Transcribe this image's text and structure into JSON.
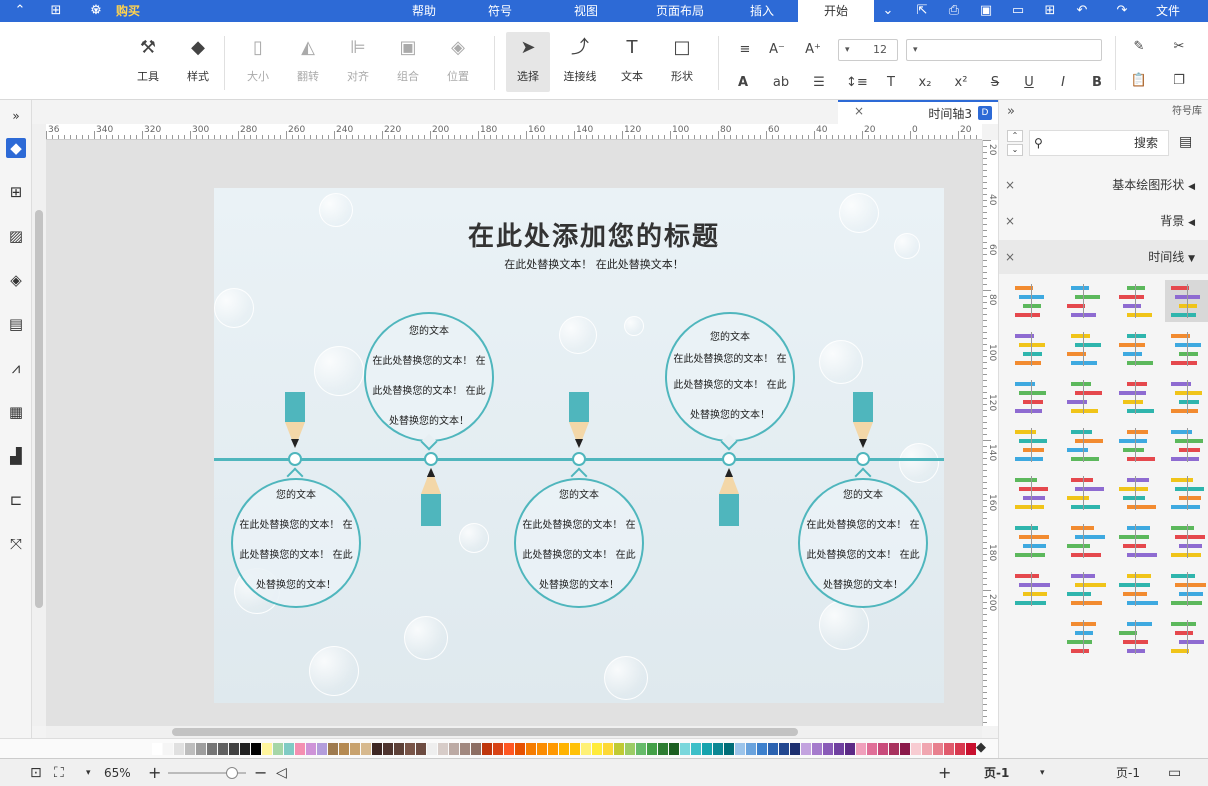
{
  "menubar": {
    "tabs": [
      "文件",
      "开始",
      "插入",
      "页面布局",
      "视图",
      "符号",
      "帮助"
    ],
    "buy_label": "购买"
  },
  "ribbon": {
    "groups_left": [
      {
        "label": "工具",
        "icon": "tool-icon"
      },
      {
        "label": "样式",
        "icon": "paint-bucket-icon"
      },
      {
        "label": "大小",
        "icon": "size-icon"
      },
      {
        "label": "翻转",
        "icon": "flip-icon"
      },
      {
        "label": "对齐",
        "icon": "align-icon"
      },
      {
        "label": "组合",
        "icon": "group-icon"
      },
      {
        "label": "位置",
        "icon": "layers-icon"
      },
      {
        "label": "选择",
        "icon": "select-cursor-icon"
      },
      {
        "label": "连接线",
        "icon": "connector-icon"
      },
      {
        "label": "文本",
        "icon": "text-T-icon"
      },
      {
        "label": "形状",
        "icon": "rectangle-icon"
      }
    ],
    "font_size": "12"
  },
  "library": {
    "header": "符号库",
    "search_placeholder": "搜索",
    "sections": [
      "基本绘图形状",
      "背景",
      "时间线"
    ]
  },
  "document": {
    "tab_title": "时间轴3"
  },
  "sidebar_icons": [
    "fill-icon",
    "grid-icon",
    "image-icon",
    "layers-icon",
    "page-icon",
    "chart-icon",
    "table-icon",
    "org-icon",
    "timeline-icon",
    "shuffle-icon"
  ],
  "ruler": {
    "h_labels": [
      "36",
      "340",
      "320",
      "300",
      "280",
      "260",
      "240",
      "220",
      "200",
      "180",
      "160",
      "140",
      "120",
      "100",
      "80",
      "60",
      "40",
      "20",
      "0",
      "20"
    ],
    "v_labels": [
      "20",
      "40",
      "60",
      "80",
      "100",
      "120",
      "140",
      "160",
      "180",
      "200"
    ]
  },
  "diagram": {
    "title": "在此处添加您的标题",
    "subtitle": "在此处替换文本！ 在此处替换文本！",
    "bubbles_top": [
      {
        "lines": [
          "您的文本",
          "在此处替换您的文本！ 在",
          "此处替换您的文本！ 在此",
          "处替换您的文本！"
        ]
      },
      {
        "lines": [
          "您的文本",
          "在此处替换您的文本！ 在",
          "此处替换您的文本！ 在此",
          "处替换您的文本！"
        ]
      }
    ],
    "bubbles_bottom": [
      {
        "lines": [
          "您的文本",
          "在此处替换您的文本！ 在",
          "此处替换您的文本！ 在此",
          "处替换您的文本！"
        ]
      },
      {
        "lines": [
          "您的文本",
          "在此处替换您的文本！ 在",
          "此处替换您的文本！ 在此",
          "处替换您的文本！"
        ]
      },
      {
        "lines": [
          "您的文本",
          "在此处替换您的文本！ 在",
          "此处替换您的文本！ 在此",
          "处替换您的文本！"
        ]
      }
    ],
    "accent": "#4fb6bd"
  },
  "status": {
    "page_label_left": "页-1",
    "page_label_right": "页-1",
    "zoom": "65%"
  },
  "colors": {
    "brand": "#2d6ad6",
    "timeline": "#4fb6bd"
  }
}
